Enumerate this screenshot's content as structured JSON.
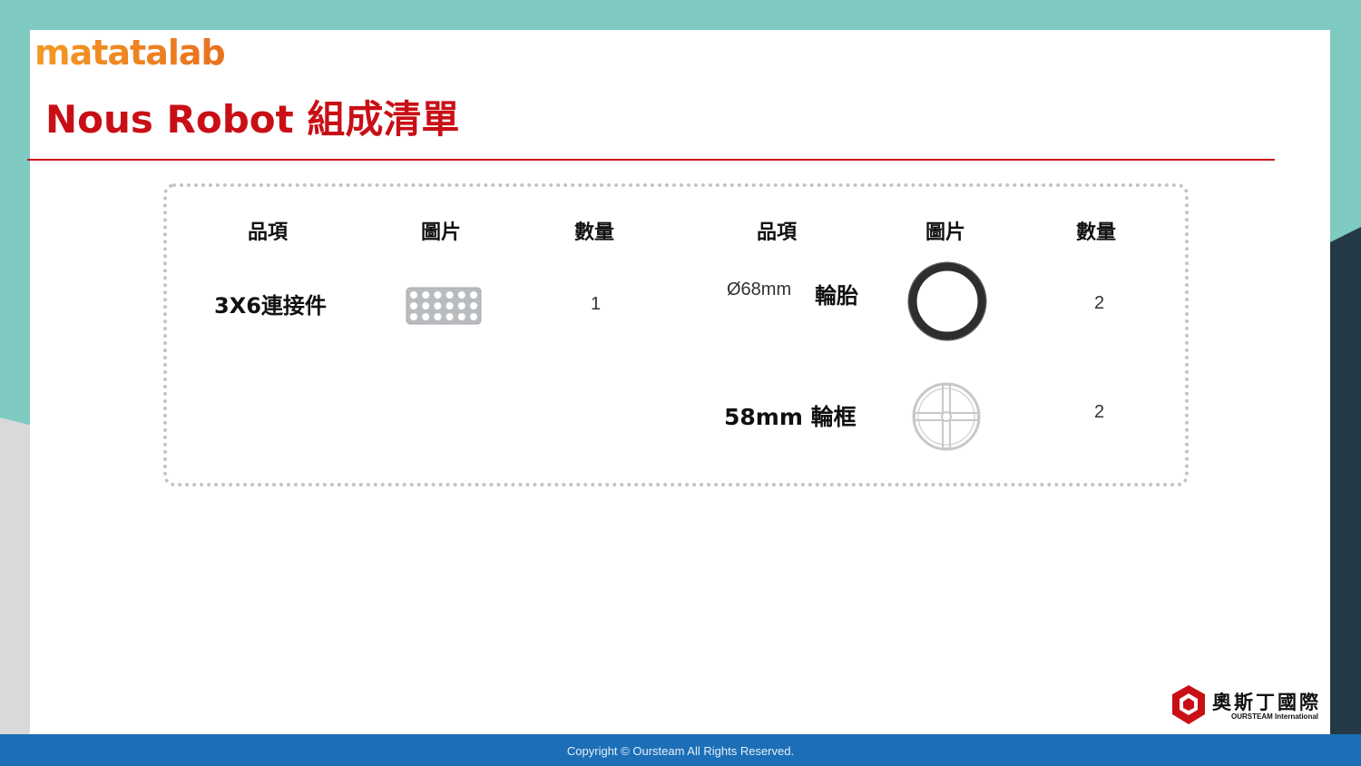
{
  "logo": {
    "text": "matatalab"
  },
  "title": "Nous Robot 組成清單",
  "headers": {
    "left": {
      "item": "品項",
      "image": "圖片",
      "qty": "數量"
    },
    "right": {
      "item": "品項",
      "image": "圖片",
      "qty": "數量"
    }
  },
  "left_rows": [
    {
      "name": "3X6連接件",
      "image": "connector-3x6-image",
      "qty": "1"
    }
  ],
  "right_rows": [
    {
      "name_prefix": "Ø68mm",
      "name_suffix": "輪胎",
      "image": "tire-image",
      "qty": "2"
    },
    {
      "name": "58mm 輪框",
      "image": "wheel-rim-image",
      "qty": "2"
    }
  ],
  "footer": {
    "copyright": "Copyright © Oursteam All Rights Reserved."
  },
  "brand": {
    "cn": "奧斯丁國際",
    "en": "OURSTEAM International"
  },
  "colors": {
    "accent_red": "#c90f16",
    "teal_background": "#7ecac0",
    "footer_blue": "#1c6fb6",
    "logo_orange": "#f08a22"
  }
}
